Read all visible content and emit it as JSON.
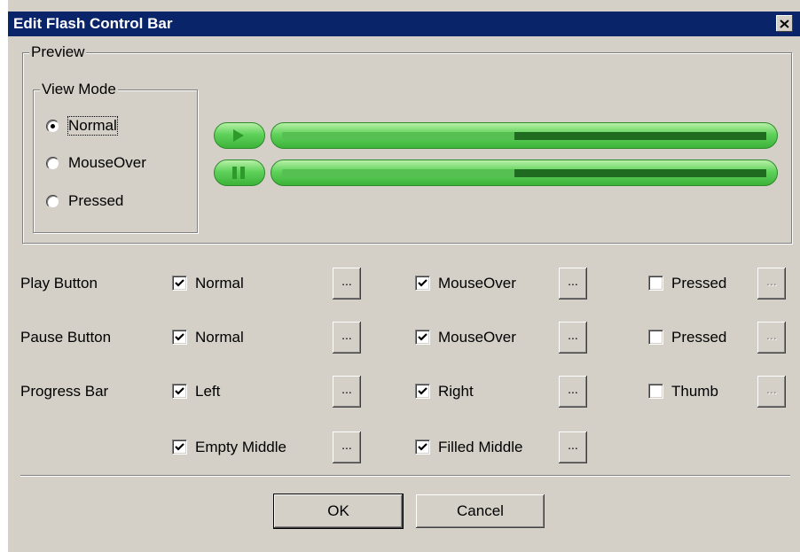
{
  "window": {
    "title": "Edit Flash Control Bar",
    "close_label": "✕"
  },
  "preview": {
    "legend": "Preview",
    "view_mode": {
      "legend": "View Mode",
      "options": [
        "Normal",
        "MouseOver",
        "Pressed"
      ],
      "selected": "Normal"
    },
    "progress_fill": 0.52
  },
  "rows": [
    {
      "label": "Play Button",
      "items": [
        {
          "label": "Normal",
          "checked": true,
          "browse": "..."
        },
        {
          "label": "MouseOver",
          "checked": true,
          "browse": "..."
        },
        {
          "label": "Pressed",
          "checked": false,
          "browse": "..."
        }
      ]
    },
    {
      "label": "Pause Button",
      "items": [
        {
          "label": "Normal",
          "checked": true,
          "browse": "..."
        },
        {
          "label": "MouseOver",
          "checked": true,
          "browse": "..."
        },
        {
          "label": "Pressed",
          "checked": false,
          "browse": "..."
        }
      ]
    },
    {
      "label": "Progress Bar",
      "items": [
        {
          "label": "Left",
          "checked": true,
          "browse": "..."
        },
        {
          "label": "Right",
          "checked": true,
          "browse": "..."
        },
        {
          "label": "Thumb",
          "checked": false,
          "browse": "..."
        }
      ]
    },
    {
      "label": "",
      "items": [
        {
          "label": "Empty Middle",
          "checked": true,
          "browse": "..."
        },
        {
          "label": "Filled Middle",
          "checked": true,
          "browse": "..."
        }
      ]
    }
  ],
  "buttons": {
    "ok": "OK",
    "cancel": "Cancel"
  },
  "colors": {
    "title_bar": "#0a246a",
    "face": "#d4d0c8",
    "control_green": "#5fd25a",
    "progress_dark": "#1f6b1f"
  }
}
